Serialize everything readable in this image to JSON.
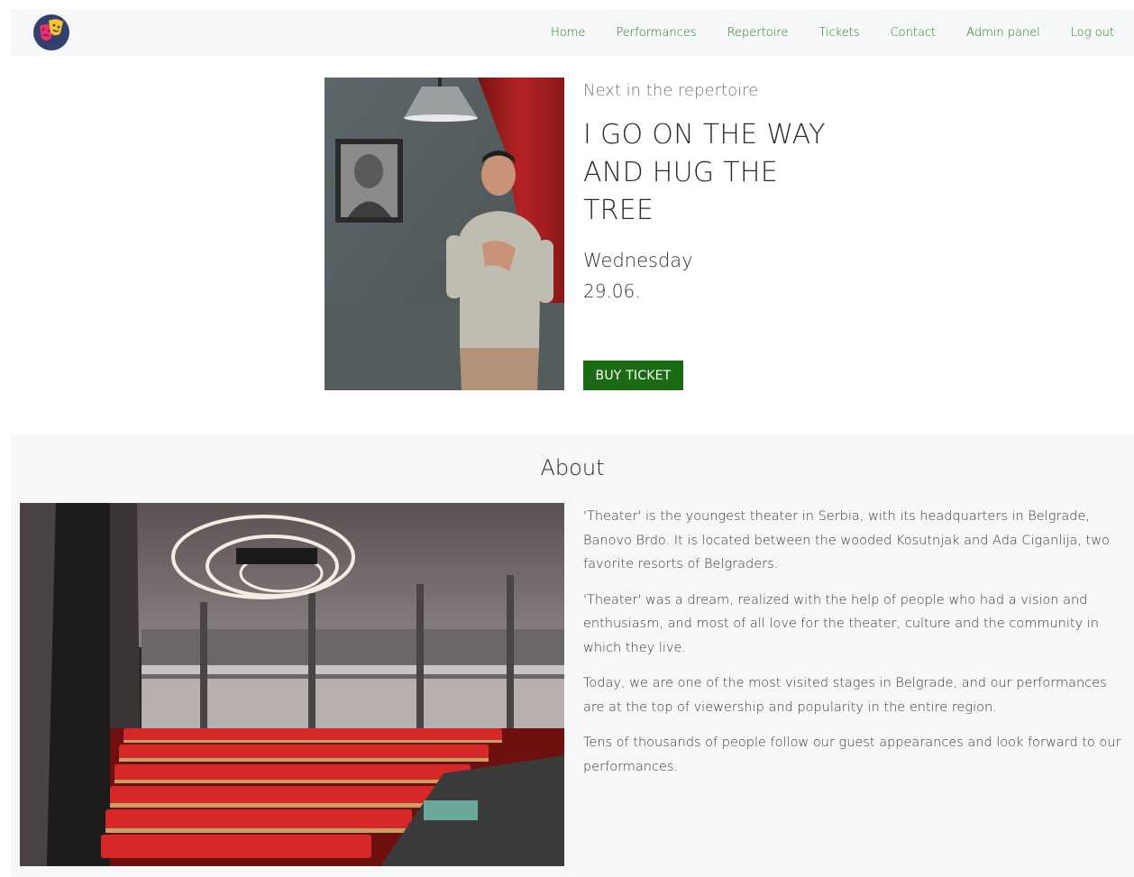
{
  "nav": {
    "logo_icon": "theater-masks-icon",
    "items": [
      {
        "label": "Home"
      },
      {
        "label": "Performances"
      },
      {
        "label": "Repertoire"
      },
      {
        "label": "Tickets"
      },
      {
        "label": "Contact"
      },
      {
        "label": "Admin panel"
      },
      {
        "label": "Log out"
      }
    ],
    "link_color": "#237a1f"
  },
  "hero": {
    "eyebrow": "Next in the repertoire",
    "title": "I GO ON THE WAY AND HUG THE TREE",
    "day": "Wednesday",
    "date": "29.06.",
    "button_label": "BUY TICKET",
    "button_color": "#1a6b14"
  },
  "about": {
    "title": "About",
    "paragraphs": [
      "'Theater' is the youngest theater in Serbia, with its headquarters in Belgrade, Banovo Brdo. It is located between the wooded Kosutnjak and Ada Ciganlija, two favorite resorts of Belgraders.",
      "'Theater' was a dream, realized with the help of people who had a vision and enthusiasm, and most of all love for the theater, culture and the community in which they live.",
      "Today, we are one of the most visited stages in Belgrade, and our performances are at the top of viewership and popularity in the entire region.",
      "Tens of thousands of people follow our guest appearances and look forward to our performances."
    ]
  }
}
